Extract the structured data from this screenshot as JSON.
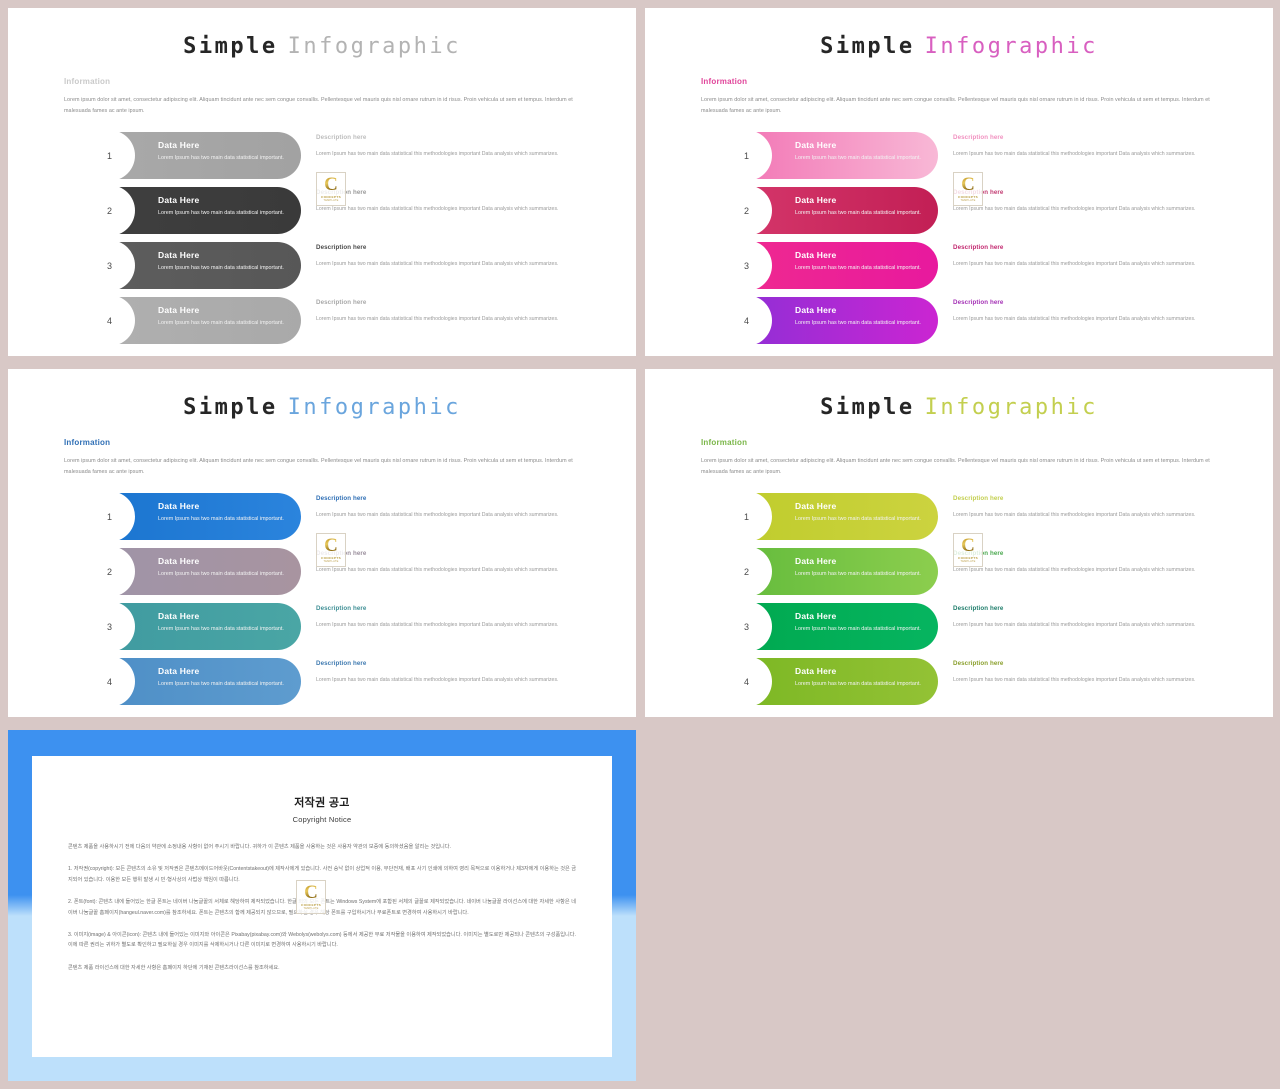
{
  "background_color": "#d8c8c6",
  "watermark": {
    "letter": "C",
    "line1": "CONCEPTS",
    "line2": "TEMPLATE"
  },
  "common": {
    "title_strong": "Simple",
    "title_accent": "Infographic",
    "information_heading": "Information",
    "information_body": "Lorem  ipsum dolor sit amet, consectetur adipiscing elit. Aliquam tincidunt ante nec sem congue convallis. Pellentesque vel mauris quis nisl ornare rutrum in id risus. Proin vehicula ut sem et tempus. Interdum et malesuada fames ac ante ipsum.",
    "pill_title": "Data Here",
    "pill_sub": "Lorem  Ipsum has two main data statistical important.",
    "desc_head": "Description here",
    "desc_body": "Lorem  Ipsum has two main data statistical this methodologies important Data analysis which summarizes."
  },
  "slides": [
    {
      "name": "gray",
      "accent_title": "#b3b3b3",
      "info_heading_color": "#c9c9c9",
      "rows": [
        {
          "number": "1",
          "pill_from": "#a9a9a9",
          "pill_to": "#a2a2a2",
          "desc_color": "#bdbdbd"
        },
        {
          "number": "2",
          "pill_from": "#3f3f3f",
          "pill_to": "#3a3a3a",
          "desc_color": "#9a9a9a"
        },
        {
          "number": "3",
          "pill_from": "#5e5e5e",
          "pill_to": "#575757",
          "desc_color": "#4a4a4a"
        },
        {
          "number": "4",
          "pill_from": "#b0b0b0",
          "pill_to": "#a9a9a9",
          "desc_color": "#a8a8a8"
        }
      ]
    },
    {
      "name": "pink",
      "accent_title": "#d85fc0",
      "info_heading_color": "#e0459a",
      "rows": [
        {
          "number": "1",
          "pill_from": "#f274b4",
          "pill_to": "#f8b8d6",
          "desc_color": "#f191c0"
        },
        {
          "number": "2",
          "pill_from": "#d5376b",
          "pill_to": "#c21f55",
          "desc_color": "#c23c72"
        },
        {
          "number": "3",
          "pill_from": "#ef2a8f",
          "pill_to": "#e8199e",
          "desc_color": "#c2276f"
        },
        {
          "number": "4",
          "pill_from": "#8e2fd6",
          "pill_to": "#cb25d2",
          "desc_color": "#a431b5"
        }
      ]
    },
    {
      "name": "blue",
      "accent_title": "#6aa5dd",
      "info_heading_color": "#2f6fb5",
      "rows": [
        {
          "number": "1",
          "pill_from": "#1a74cf",
          "pill_to": "#2b84dd",
          "desc_color": "#2f6fb5"
        },
        {
          "number": "2",
          "pill_from": "#9f94a8",
          "pill_to": "#a894a0",
          "desc_color": "#9a8e9c"
        },
        {
          "number": "3",
          "pill_from": "#3f9aa0",
          "pill_to": "#4aa6a5",
          "desc_color": "#3f8f95"
        },
        {
          "number": "4",
          "pill_from": "#4d8ec6",
          "pill_to": "#5e9ccf",
          "desc_color": "#3f7ab0"
        }
      ]
    },
    {
      "name": "green",
      "accent_title": "#c3cf4f",
      "info_heading_color": "#7ab648",
      "rows": [
        {
          "number": "1",
          "pill_from": "#bfcc2c",
          "pill_to": "#ccd33f",
          "desc_color": "#c3cf4f"
        },
        {
          "number": "2",
          "pill_from": "#63bb3c",
          "pill_to": "#8cce4e",
          "desc_color": "#4aa84f"
        },
        {
          "number": "3",
          "pill_from": "#00a84f",
          "pill_to": "#06b560",
          "desc_color": "#1f7d6b"
        },
        {
          "number": "4",
          "pill_from": "#7bb723",
          "pill_to": "#93c235",
          "desc_color": "#8a9f2c"
        }
      ]
    }
  ],
  "copyright": {
    "title": "저작권 공고",
    "subtitle": "Copyright Notice",
    "paragraphs": [
      "콘텐츠 제품을 사용하시기 전에 다음의 약관에 소정내용 사항이 없어 주시기 바랍니다. 귀하가 이 콘텐츠 제품을 사용하는 것은 사용자 약관의 보증에 동의하셨음을 알리는 것입니다.",
      "1. 저작권(copyright): 모든 콘텐츠의 소유 및 저작권은 콘텐츠메이드어바웃(Contentstakeout)에 제작사에게 있습니다. 사전 승낙 없이 상업적 이용, 무단전재, 배포 사기 인쇄에 의하여 영리 목적으로 이용하거나 제3자에게 이용하는 것은 금지되어 있습니다. 이용한 모든 행위 발생 시 민·형사상의 사법상 책임이 따릅니다.",
      "2. 폰트(font): 콘텐츠 내에 들어있는 한글 폰트는 네이버 나눔글꼴의 서체로 해당하여 제작되었습니다. 한글 외의 모든 폰트는 Windows System에 포함된 서체의 글꼴로 제작되었습니다. 네이버 나눔글꼴 라이선스에 대한 자세한 사항은 네이버 나눔글꼴 홈페이지(hangeul.naver.com)를 참조하세요. 폰트는 콘텐츠의 함께 제공되지 않으므로, 필요하실 경우 해당 폰트를 구입하시거나 무료폰트로 변경하여 사용하시기 바랍니다.",
      "3. 이미지(image) & 아이콘(icon): 콘텐츠 내에 들어있는 이미지와 아이콘은 Pixabay(pixabay.com)와 Webolys(webolys.com) 등에서 제공한 무료 저작물을 이용하여 제작되었습니다. 이미지는 별도로만 제공되나 콘텐츠의 구성품입니다. 이에 따른 권리는 귀하가 별도로 확인하고 필요하실 경우 이미지를 삭제하시거나 다른 이미지로 변경하여 사용하시기 바랍니다.",
      "콘텐츠 제품 라이선스에 대한 자세한 사항은 홈페이지 하단에 기재된 콘텐츠라이선스를 참조하세요."
    ]
  }
}
